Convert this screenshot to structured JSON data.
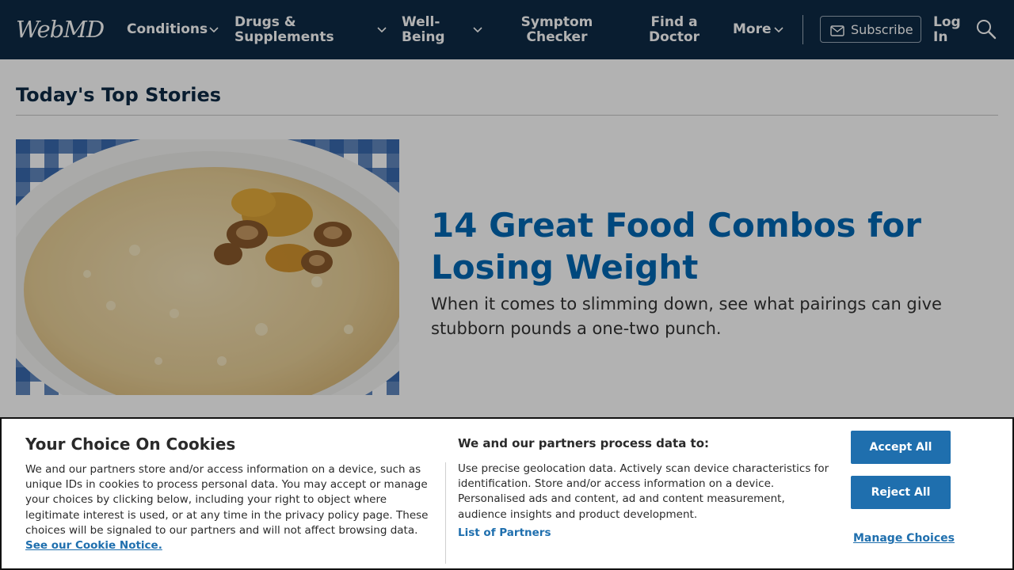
{
  "header": {
    "logo": "WebMD",
    "nav": {
      "conditions": "Conditions",
      "drugs_line1": "Drugs &",
      "drugs_line2": "Supplements",
      "wellbeing_line1": "Well-",
      "wellbeing_line2": "Being",
      "symptom_line1": "Symptom",
      "symptom_line2": "Checker",
      "doctor_line1": "Find a",
      "doctor_line2": "Doctor",
      "more": "More"
    },
    "subscribe_label": "Subscribe",
    "login_line1": "Log",
    "login_line2": "In"
  },
  "main": {
    "section_title": "Today's Top Stories",
    "story": {
      "title": "14 Great Food Combos for Losing Weight",
      "description": "When it comes to slimming down, see what pairings can give stubborn pounds a one-two punch."
    }
  },
  "cookie_banner": {
    "title": "Your Choice On Cookies",
    "body": "We and our partners store and/or access information on a device, such as unique IDs in cookies to process personal data. You may accept or manage your choices by clicking below, including your right to object where legitimate interest is used, or at any time in the privacy policy page. These choices will be signaled to our partners and will not affect browsing data. ",
    "notice_link": "See our Cookie Notice.",
    "purposes_heading": "We and our partners process data to:",
    "purposes_text": "Use precise geolocation data. Actively scan device characteristics for identification. Store and/or access information on a device. Personalised ads and content, ad and content measurement, audience insights and product development.",
    "partners_link": "List of Partners",
    "accept_label": "Accept All",
    "reject_label": "Reject All",
    "manage_label": "Manage Choices"
  },
  "colors": {
    "header_bg": "#0e2a45",
    "headline_blue": "#0068b3",
    "button_blue": "#1f6fae"
  }
}
